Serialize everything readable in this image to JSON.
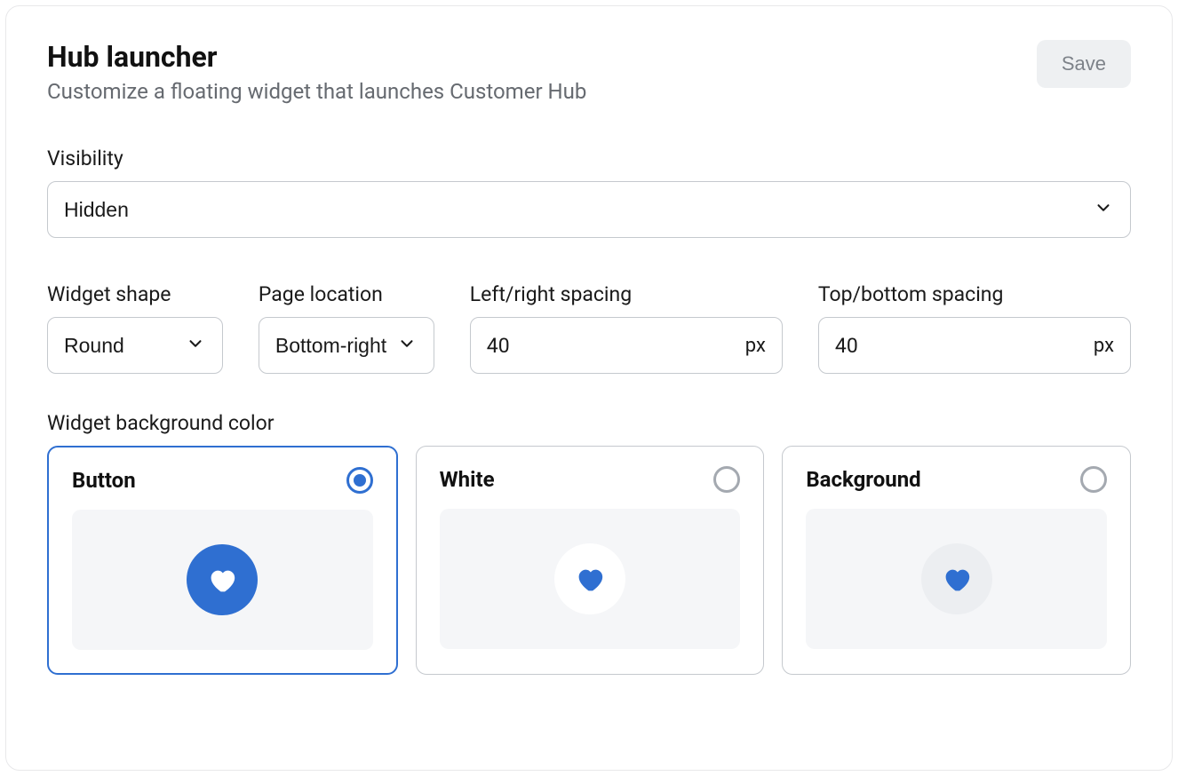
{
  "header": {
    "title": "Hub launcher",
    "subtitle": "Customize a floating widget that launches Customer Hub",
    "save_label": "Save"
  },
  "visibility": {
    "label": "Visibility",
    "value": "Hidden"
  },
  "shape": {
    "label": "Widget shape",
    "value": "Round"
  },
  "location": {
    "label": "Page location",
    "value": "Bottom-right"
  },
  "lr_spacing": {
    "label": "Left/right spacing",
    "value": "40",
    "unit": "px"
  },
  "tb_spacing": {
    "label": "Top/bottom spacing",
    "value": "40",
    "unit": "px"
  },
  "bgcolor": {
    "label": "Widget background color",
    "options": {
      "button": "Button",
      "white": "White",
      "background": "Background"
    },
    "selected": "button"
  },
  "colors": {
    "accent": "#2f6fd1"
  }
}
